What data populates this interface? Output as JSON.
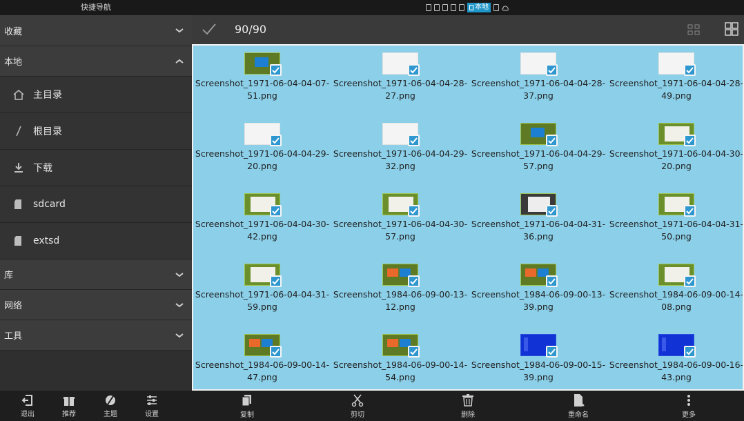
{
  "topbar": {
    "title": "快捷导航",
    "active_tab": "本地"
  },
  "header": {
    "count": "90/90"
  },
  "sidebar": {
    "favorites": "收藏",
    "local": "本地",
    "items": [
      {
        "label": "主目录",
        "icon": "home-icon"
      },
      {
        "label": "根目录",
        "icon": "slash-icon"
      },
      {
        "label": "下载",
        "icon": "download-icon"
      },
      {
        "label": "sdcard",
        "icon": "sdcard-icon"
      },
      {
        "label": "extsd",
        "icon": "sdcard-icon"
      }
    ],
    "library": "库",
    "network": "网络",
    "tools": "工具"
  },
  "side_tools": [
    {
      "label": "退出",
      "icon": "exit-icon"
    },
    {
      "label": "推荐",
      "icon": "gift-icon"
    },
    {
      "label": "主题",
      "icon": "theme-icon"
    },
    {
      "label": "设置",
      "icon": "settings-icon"
    }
  ],
  "files": [
    {
      "name": "Screenshot_1971-06-04-04-07-51.png",
      "thumb": "green"
    },
    {
      "name": "Screenshot_1971-06-04-04-28-27.png",
      "thumb": "white"
    },
    {
      "name": "Screenshot_1971-06-04-04-28-37.png",
      "thumb": "white"
    },
    {
      "name": "Screenshot_1971-06-04-04-28-49.png",
      "thumb": "white"
    },
    {
      "name": "Screenshot_1971-06-04-04-29-20.png",
      "thumb": "white"
    },
    {
      "name": "Screenshot_1971-06-04-04-29-32.png",
      "thumb": "white"
    },
    {
      "name": "Screenshot_1971-06-04-04-29-57.png",
      "thumb": "green"
    },
    {
      "name": "Screenshot_1971-06-04-04-30-20.png",
      "thumb": "whitedoc"
    },
    {
      "name": "Screenshot_1971-06-04-04-30-42.png",
      "thumb": "whitedoc"
    },
    {
      "name": "Screenshot_1971-06-04-04-30-57.png",
      "thumb": "whitedoc"
    },
    {
      "name": "Screenshot_1971-06-04-04-31-36.png",
      "thumb": "dark"
    },
    {
      "name": "Screenshot_1971-06-04-04-31-50.png",
      "thumb": "whitedoc"
    },
    {
      "name": "Screenshot_1971-06-04-04-31-59.png",
      "thumb": "whitedoc"
    },
    {
      "name": "Screenshot_1984-06-09-00-13-12.png",
      "thumb": "colorful"
    },
    {
      "name": "Screenshot_1984-06-09-00-13-39.png",
      "thumb": "colorful"
    },
    {
      "name": "Screenshot_1984-06-09-00-14-08.png",
      "thumb": "whitedoc"
    },
    {
      "name": "Screenshot_1984-06-09-00-14-47.png",
      "thumb": "colorful"
    },
    {
      "name": "Screenshot_1984-06-09-00-14-54.png",
      "thumb": "colorful"
    },
    {
      "name": "Screenshot_1984-06-09-00-15-39.png",
      "thumb": "blue"
    },
    {
      "name": "Screenshot_1984-06-09-00-16-43.png",
      "thumb": "blue"
    }
  ],
  "actions": [
    {
      "label": "复制",
      "icon": "copy-icon"
    },
    {
      "label": "剪切",
      "icon": "cut-icon"
    },
    {
      "label": "删除",
      "icon": "delete-icon"
    },
    {
      "label": "重命名",
      "icon": "rename-icon"
    },
    {
      "label": "更多",
      "icon": "more-icon"
    }
  ],
  "colors": {
    "selection_bg": "#8bcfe8",
    "accent": "#2e97cf",
    "sidebar_bg": "#2f2f2f"
  }
}
